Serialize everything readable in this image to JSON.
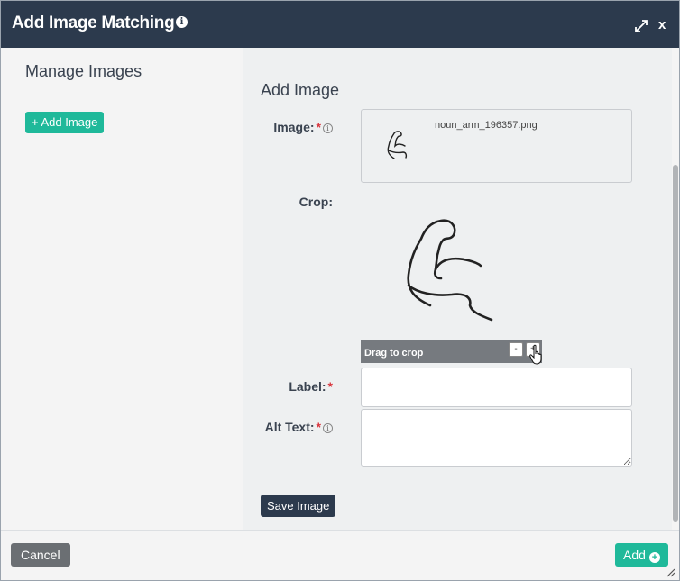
{
  "dialog": {
    "title": "Add Image Matching",
    "info_icon": "i",
    "close_label": "x"
  },
  "left_panel": {
    "title": "Manage Images",
    "add_image_button": "+ Add Image"
  },
  "form": {
    "title": "Add Image",
    "image_label": "Image:",
    "image_filename": "noun_arm_196357.png",
    "crop_label": "Crop:",
    "crop_bar_text": "Drag to crop",
    "zoom_out": "-",
    "zoom_in": "+",
    "label_label": "Label:",
    "label_value": "",
    "alt_text_label": "Alt Text:",
    "alt_text_value": "",
    "required_marker": "*",
    "help_icon": "i",
    "save_button": "Save Image"
  },
  "footer": {
    "cancel_button": "Cancel",
    "add_button": "Add",
    "add_icon": "+"
  },
  "colors": {
    "titlebar": "#2c3a4d",
    "accent": "#1fb99a",
    "required": "#d9363e"
  }
}
